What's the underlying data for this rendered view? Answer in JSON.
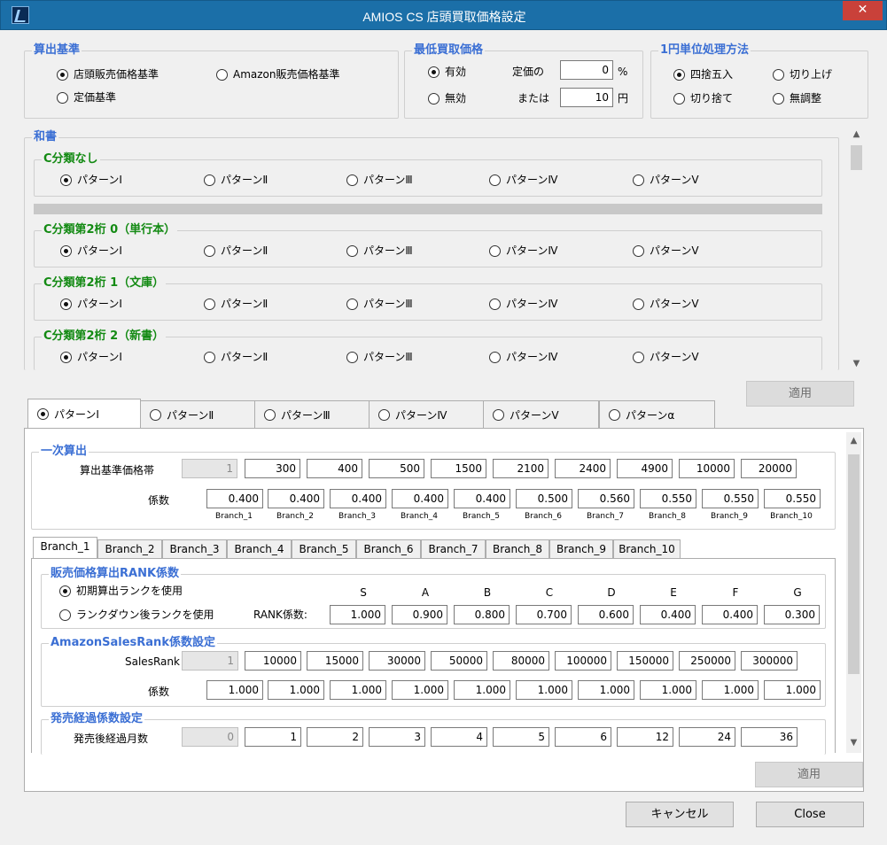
{
  "window": {
    "title": "AMIOS CS 店頭買取価格設定",
    "close_glyph": "✕"
  },
  "calc_basis": {
    "title": "算出基準",
    "options": [
      "店頭販売価格基準",
      "Amazon販売価格基準",
      "定価基準"
    ],
    "selected": 0
  },
  "min_price": {
    "title": "最低買取価格",
    "enabled_label": "有効",
    "disabled_label": "無効",
    "list_price_label": "定価の",
    "percent_value": "0",
    "percent_unit": "%",
    "or_label": "または",
    "yen_value": "10",
    "yen_unit": "円"
  },
  "rounding": {
    "title": "1円単位処理方法",
    "options": [
      "四捨五入",
      "切り上げ",
      "切り捨て",
      "無調整"
    ],
    "selected": 0
  },
  "washo": {
    "title": "和書",
    "patterns": [
      "パターンⅠ",
      "パターンⅡ",
      "パターンⅢ",
      "パターンⅣ",
      "パターンⅤ"
    ],
    "groups": [
      {
        "title": "C分類なし"
      },
      {
        "title": "C分類第2桁 0（単行本）"
      },
      {
        "title": "C分類第2桁 1（文庫）"
      },
      {
        "title": "C分類第2桁 2（新書）"
      }
    ]
  },
  "apply_label": "適用",
  "pattern_tabs": [
    "パターンⅠ",
    "パターンⅡ",
    "パターンⅢ",
    "パターンⅣ",
    "パターンⅤ",
    "パターンα"
  ],
  "primary": {
    "title": "一次算出",
    "band_label": "算出基準価格帯",
    "bands": [
      "1",
      "300",
      "400",
      "500",
      "1500",
      "2100",
      "2400",
      "4900",
      "10000",
      "20000"
    ],
    "coef_label": "係数",
    "coefs": [
      "0.400",
      "0.400",
      "0.400",
      "0.400",
      "0.400",
      "0.500",
      "0.560",
      "0.550",
      "0.550",
      "0.550"
    ],
    "branches": [
      "Branch_1",
      "Branch_2",
      "Branch_3",
      "Branch_4",
      "Branch_5",
      "Branch_6",
      "Branch_7",
      "Branch_8",
      "Branch_9",
      "Branch_10"
    ]
  },
  "branch_tabs": [
    "Branch_1",
    "Branch_2",
    "Branch_3",
    "Branch_4",
    "Branch_5",
    "Branch_6",
    "Branch_7",
    "Branch_8",
    "Branch_9",
    "Branch_10"
  ],
  "rank": {
    "title": "販売価格算出RANK係数",
    "opt1": "初期算出ランクを使用",
    "opt2": "ランクダウン後ランクを使用",
    "coef_label": "RANK係数:",
    "headers": [
      "S",
      "A",
      "B",
      "C",
      "D",
      "E",
      "F",
      "G"
    ],
    "values": [
      "1.000",
      "0.900",
      "0.800",
      "0.700",
      "0.600",
      "0.400",
      "0.400",
      "0.300"
    ]
  },
  "sales_rank": {
    "title": "AmazonSalesRank係数設定",
    "rank_label": "SalesRank",
    "ranks": [
      "1",
      "10000",
      "15000",
      "30000",
      "50000",
      "80000",
      "100000",
      "150000",
      "250000",
      "300000"
    ],
    "coef_label": "係数",
    "coefs": [
      "1.000",
      "1.000",
      "1.000",
      "1.000",
      "1.000",
      "1.000",
      "1.000",
      "1.000",
      "1.000",
      "1.000"
    ]
  },
  "elapsed": {
    "title": "発売経過係数設定",
    "label": "発売後経過月数",
    "months": [
      "0",
      "1",
      "2",
      "3",
      "4",
      "5",
      "6",
      "12",
      "24",
      "36"
    ]
  },
  "cancel_label": "キャンセル",
  "close_label": "Close"
}
